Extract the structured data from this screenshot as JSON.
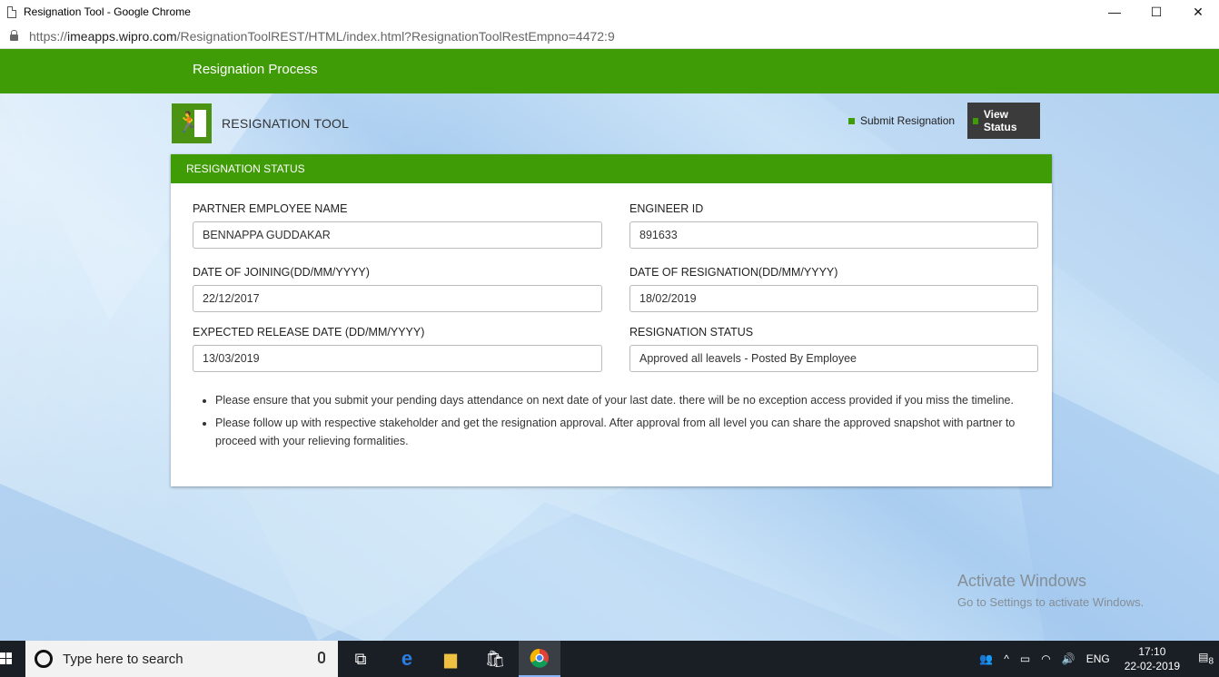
{
  "browser": {
    "window_title": "Resignation Tool - Google Chrome",
    "url_scheme": "https://",
    "url_host": "imeapps.wipro.com",
    "url_path": "/ResignationToolREST/HTML/index.html?ResignationToolRestEmpno=4472:9",
    "controls": {
      "minimize": "—",
      "maximize": "☐",
      "close": "✕"
    }
  },
  "header": {
    "title": "Resignation Process"
  },
  "tool": {
    "name": "RESIGNATION TOOL",
    "logo_icon": "exit-door-icon",
    "nav": {
      "submit": "Submit Resignation",
      "view": "View Status"
    }
  },
  "panel": {
    "heading": "RESIGNATION STATUS",
    "fields": {
      "partner_name": {
        "label": "PARTNER EMPLOYEE NAME",
        "value": "BENNAPPA GUDDAKAR"
      },
      "engineer_id": {
        "label": "ENGINEER ID",
        "value": "891633"
      },
      "doj": {
        "label": "DATE OF JOINING(DD/MM/YYYY)",
        "value": "22/12/2017"
      },
      "dor": {
        "label": "DATE OF RESIGNATION(DD/MM/YYYY)",
        "value": "18/02/2019"
      },
      "release": {
        "label": "EXPECTED RELEASE DATE (DD/MM/YYYY)",
        "value": "13/03/2019"
      },
      "status": {
        "label": "RESIGNATION STATUS",
        "value": "Approved all leavels - Posted By Employee"
      }
    },
    "notes": [
      "Please ensure that you submit your pending days attendance on next date of your last date. there will be no exception access provided if you miss the timeline.",
      "Please follow up with respective stakeholder and get the resignation approval. After approval from all level you can share the approved snapshot with partner to proceed with your relieving formalities."
    ]
  },
  "watermark": {
    "line1": "Activate Windows",
    "line2": "Go to Settings to activate Windows."
  },
  "taskbar": {
    "search_placeholder": "Type here to search",
    "language": "ENG",
    "time": "17:10",
    "date": "22-02-2019",
    "notifications": "8"
  },
  "colors": {
    "brand_green": "#3f9b06",
    "active_nav": "#3b3b3b"
  }
}
